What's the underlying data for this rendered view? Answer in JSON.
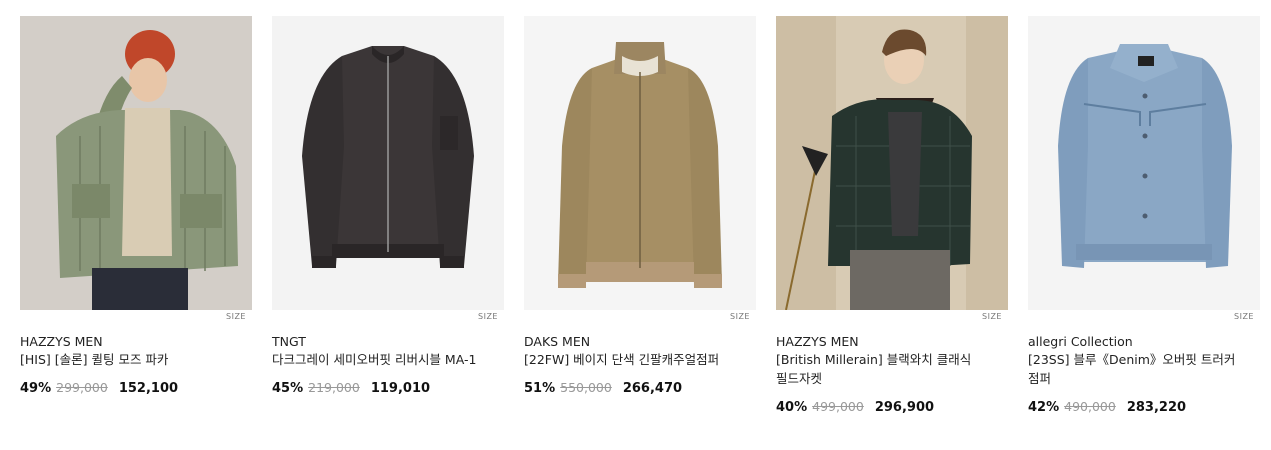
{
  "products": [
    {
      "brand": "HAZZYS MEN",
      "name": "[HIS] [솔론] 퀼팅 모즈 파카",
      "discount": "49%",
      "original_price": "299,000",
      "sale_price": "152,100",
      "size_label": "SIZE",
      "image": "model-olive-quilted-parka"
    },
    {
      "brand": "TNGT",
      "name": "다크그레이 세미오버핏 리버시블 MA-1",
      "discount": "45%",
      "original_price": "219,000",
      "sale_price": "119,010",
      "size_label": "SIZE",
      "image": "dark-grey-ma1-bomber"
    },
    {
      "brand": "DAKS MEN",
      "name": "[22FW] 베이지 단색 긴팔캐주얼점퍼",
      "discount": "51%",
      "original_price": "550,000",
      "sale_price": "266,470",
      "size_label": "SIZE",
      "image": "beige-zip-jacket"
    },
    {
      "brand": "HAZZYS MEN",
      "name": "[British Millerain] 블랙와치 클래식 필드자켓",
      "discount": "40%",
      "original_price": "499,000",
      "sale_price": "296,900",
      "size_label": "SIZE",
      "image": "model-blackwatch-field-jacket"
    },
    {
      "brand": "allegri Collection",
      "name": "[23SS] 블루《Denim》오버핏 트러커 점퍼",
      "discount": "42%",
      "original_price": "490,000",
      "sale_price": "283,220",
      "size_label": "SIZE",
      "image": "blue-denim-trucker-jacket"
    }
  ],
  "colors": {
    "strike": "#999999",
    "text": "#222222"
  }
}
